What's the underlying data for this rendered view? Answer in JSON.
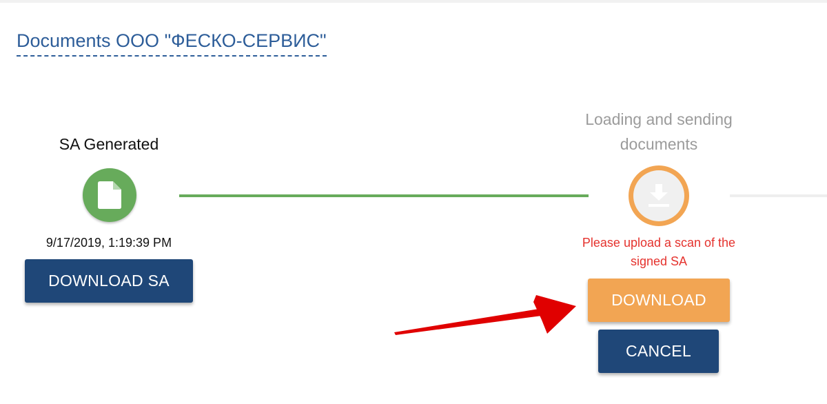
{
  "page": {
    "title": "Documents ООО \"ФЕСКО-СЕРВИС\""
  },
  "steps": [
    {
      "title": "SA Generated",
      "icon": "document-icon",
      "status": "done",
      "date": "9/17/2019, 1:19:39 PM",
      "button_label": "DOWNLOAD SA"
    },
    {
      "title": "Loading and sending documents",
      "icon": "download-icon",
      "status": "active",
      "message": "Please upload a scan of the signed SA",
      "download_label": "DOWNLOAD",
      "cancel_label": "CANCEL"
    }
  ],
  "colors": {
    "title_link": "#2d5d99",
    "done_green": "#67ab5b",
    "active_orange": "#f2a553",
    "navy_button": "#1f4778",
    "error_red": "#e5322d",
    "inactive_text": "#9b9b9b",
    "annotation_arrow": "#e00000"
  }
}
